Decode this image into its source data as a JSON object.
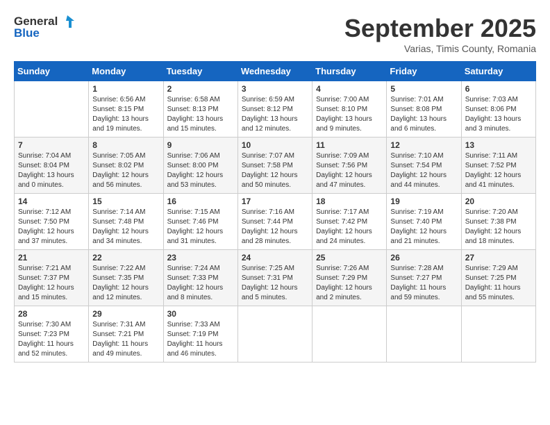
{
  "header": {
    "logo_general": "General",
    "logo_blue": "Blue",
    "month_title": "September 2025",
    "subtitle": "Varias, Timis County, Romania"
  },
  "days_of_week": [
    "Sunday",
    "Monday",
    "Tuesday",
    "Wednesday",
    "Thursday",
    "Friday",
    "Saturday"
  ],
  "weeks": [
    {
      "days": [
        {
          "num": "",
          "info": ""
        },
        {
          "num": "1",
          "info": "Sunrise: 6:56 AM\nSunset: 8:15 PM\nDaylight: 13 hours\nand 19 minutes."
        },
        {
          "num": "2",
          "info": "Sunrise: 6:58 AM\nSunset: 8:13 PM\nDaylight: 13 hours\nand 15 minutes."
        },
        {
          "num": "3",
          "info": "Sunrise: 6:59 AM\nSunset: 8:12 PM\nDaylight: 13 hours\nand 12 minutes."
        },
        {
          "num": "4",
          "info": "Sunrise: 7:00 AM\nSunset: 8:10 PM\nDaylight: 13 hours\nand 9 minutes."
        },
        {
          "num": "5",
          "info": "Sunrise: 7:01 AM\nSunset: 8:08 PM\nDaylight: 13 hours\nand 6 minutes."
        },
        {
          "num": "6",
          "info": "Sunrise: 7:03 AM\nSunset: 8:06 PM\nDaylight: 13 hours\nand 3 minutes."
        }
      ]
    },
    {
      "days": [
        {
          "num": "7",
          "info": "Sunrise: 7:04 AM\nSunset: 8:04 PM\nDaylight: 13 hours\nand 0 minutes."
        },
        {
          "num": "8",
          "info": "Sunrise: 7:05 AM\nSunset: 8:02 PM\nDaylight: 12 hours\nand 56 minutes."
        },
        {
          "num": "9",
          "info": "Sunrise: 7:06 AM\nSunset: 8:00 PM\nDaylight: 12 hours\nand 53 minutes."
        },
        {
          "num": "10",
          "info": "Sunrise: 7:07 AM\nSunset: 7:58 PM\nDaylight: 12 hours\nand 50 minutes."
        },
        {
          "num": "11",
          "info": "Sunrise: 7:09 AM\nSunset: 7:56 PM\nDaylight: 12 hours\nand 47 minutes."
        },
        {
          "num": "12",
          "info": "Sunrise: 7:10 AM\nSunset: 7:54 PM\nDaylight: 12 hours\nand 44 minutes."
        },
        {
          "num": "13",
          "info": "Sunrise: 7:11 AM\nSunset: 7:52 PM\nDaylight: 12 hours\nand 41 minutes."
        }
      ]
    },
    {
      "days": [
        {
          "num": "14",
          "info": "Sunrise: 7:12 AM\nSunset: 7:50 PM\nDaylight: 12 hours\nand 37 minutes."
        },
        {
          "num": "15",
          "info": "Sunrise: 7:14 AM\nSunset: 7:48 PM\nDaylight: 12 hours\nand 34 minutes."
        },
        {
          "num": "16",
          "info": "Sunrise: 7:15 AM\nSunset: 7:46 PM\nDaylight: 12 hours\nand 31 minutes."
        },
        {
          "num": "17",
          "info": "Sunrise: 7:16 AM\nSunset: 7:44 PM\nDaylight: 12 hours\nand 28 minutes."
        },
        {
          "num": "18",
          "info": "Sunrise: 7:17 AM\nSunset: 7:42 PM\nDaylight: 12 hours\nand 24 minutes."
        },
        {
          "num": "19",
          "info": "Sunrise: 7:19 AM\nSunset: 7:40 PM\nDaylight: 12 hours\nand 21 minutes."
        },
        {
          "num": "20",
          "info": "Sunrise: 7:20 AM\nSunset: 7:38 PM\nDaylight: 12 hours\nand 18 minutes."
        }
      ]
    },
    {
      "days": [
        {
          "num": "21",
          "info": "Sunrise: 7:21 AM\nSunset: 7:37 PM\nDaylight: 12 hours\nand 15 minutes."
        },
        {
          "num": "22",
          "info": "Sunrise: 7:22 AM\nSunset: 7:35 PM\nDaylight: 12 hours\nand 12 minutes."
        },
        {
          "num": "23",
          "info": "Sunrise: 7:24 AM\nSunset: 7:33 PM\nDaylight: 12 hours\nand 8 minutes."
        },
        {
          "num": "24",
          "info": "Sunrise: 7:25 AM\nSunset: 7:31 PM\nDaylight: 12 hours\nand 5 minutes."
        },
        {
          "num": "25",
          "info": "Sunrise: 7:26 AM\nSunset: 7:29 PM\nDaylight: 12 hours\nand 2 minutes."
        },
        {
          "num": "26",
          "info": "Sunrise: 7:28 AM\nSunset: 7:27 PM\nDaylight: 11 hours\nand 59 minutes."
        },
        {
          "num": "27",
          "info": "Sunrise: 7:29 AM\nSunset: 7:25 PM\nDaylight: 11 hours\nand 55 minutes."
        }
      ]
    },
    {
      "days": [
        {
          "num": "28",
          "info": "Sunrise: 7:30 AM\nSunset: 7:23 PM\nDaylight: 11 hours\nand 52 minutes."
        },
        {
          "num": "29",
          "info": "Sunrise: 7:31 AM\nSunset: 7:21 PM\nDaylight: 11 hours\nand 49 minutes."
        },
        {
          "num": "30",
          "info": "Sunrise: 7:33 AM\nSunset: 7:19 PM\nDaylight: 11 hours\nand 46 minutes."
        },
        {
          "num": "",
          "info": ""
        },
        {
          "num": "",
          "info": ""
        },
        {
          "num": "",
          "info": ""
        },
        {
          "num": "",
          "info": ""
        }
      ]
    }
  ]
}
